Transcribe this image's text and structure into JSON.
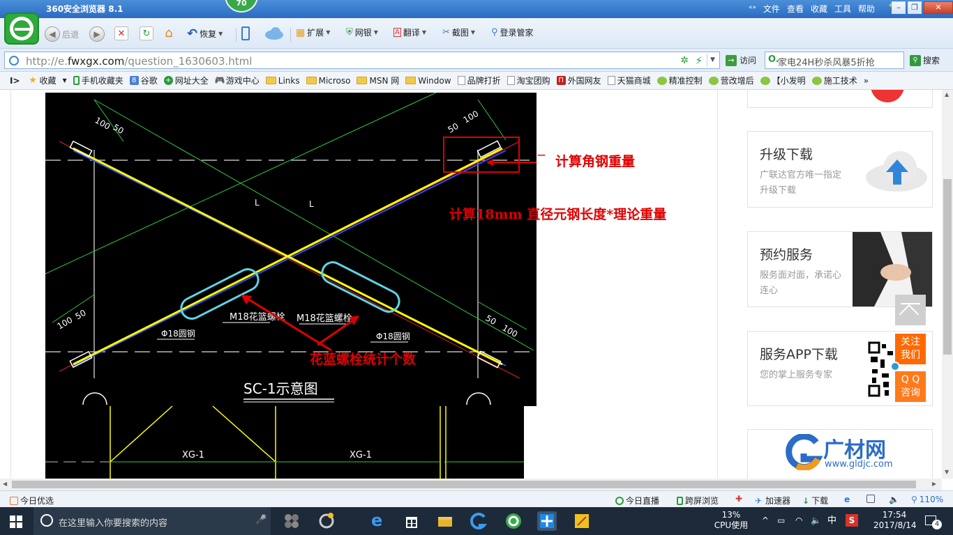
{
  "titlebar": {
    "title": "360安全浏览器 8.1",
    "badge": "70",
    "menus": [
      "文件",
      "查看",
      "收藏",
      "工具",
      "帮助"
    ]
  },
  "toolbar": {
    "back": "后退",
    "restore": "恢复",
    "extend": "扩展",
    "netbank": "网银",
    "translate": "翻译",
    "screenshot": "截图",
    "login": "登录管家"
  },
  "address": {
    "url_prefix": "http://e.",
    "url_domain": "fwxgx.com",
    "url_path": "/question_1630603.html",
    "visit_label": "访问",
    "search_value": "家电24H秒杀风暴5折抢",
    "search_label": "搜索"
  },
  "bookmarks": [
    "收藏",
    "手机收藏夹",
    "谷歌",
    "网址大全",
    "游戏中心",
    "Links",
    "Microso",
    "MSN 网",
    "Window",
    "品牌打折",
    "淘宝团购",
    "外国网友",
    "天猫商城",
    "精准控制",
    "营改增后",
    "【小发明",
    "施工技术"
  ],
  "drawing": {
    "dim_100": "100",
    "dim_50": "50",
    "label_L": "L",
    "bolt_label": "M18花篮螺栓",
    "rod_label": "Φ18圆钢",
    "caption": "SC-1示意图",
    "beam_label": "XG-1"
  },
  "annotations": {
    "angle_steel": "计算角钢重量",
    "round_steel": "计算18mm 直径元钢长度*理论重量",
    "turnbuckle": "花蓝螺栓统计个数"
  },
  "sidebar": {
    "upgrade_title": "升级下载",
    "upgrade_sub": "广联达官方唯一指定升级下载",
    "booking_title": "预约服务",
    "booking_sub": "服务面对面，承诺心连心",
    "app_title": "服务APP下载",
    "app_sub": "您的掌上服务专家",
    "follow": "关注我们",
    "qq": "Q Q咨询",
    "brand": "广材网",
    "brand_url": "www.gldjc.com"
  },
  "statusbar": {
    "today": "今日优选",
    "live": "今日直播",
    "cross_screen": "跨屏浏览",
    "accelerator": "加速器",
    "download": "下载",
    "zoom": "110%"
  },
  "taskbar": {
    "search_placeholder": "在这里输入你要搜索的内容",
    "cpu_pct": "13%",
    "cpu_label": "CPU使用",
    "ime": "中",
    "time": "17:54",
    "date": "2017/8/14",
    "notif": "4"
  },
  "colors": {
    "cad_bg": "#000000",
    "annotation_red": "#e00000",
    "rod_yellow": "#ffff00",
    "accent_orange": "#ff6a00"
  }
}
